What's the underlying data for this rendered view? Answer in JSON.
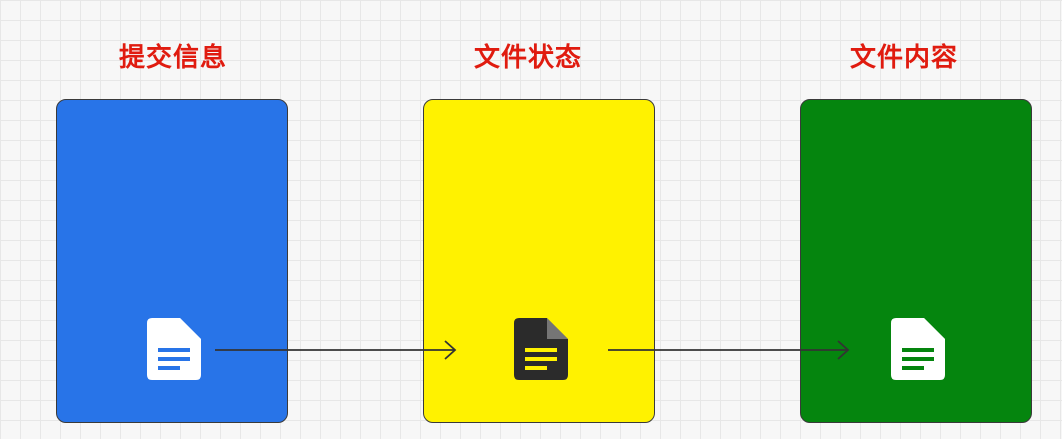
{
  "stages": [
    {
      "title": "提交信息",
      "icon": "document-icon",
      "card_color": "#2874e8",
      "icon_color": "#ffffff",
      "icon_line_color": "#2874e8"
    },
    {
      "title": "文件状态",
      "icon": "document-icon",
      "card_color": "#fff200",
      "icon_color": "#2b2b2b",
      "icon_line_color": "#fff200"
    },
    {
      "title": "文件内容",
      "icon": "document-icon",
      "card_color": "#05850e",
      "icon_color": "#ffffff",
      "icon_line_color": "#05850e"
    }
  ],
  "title_color": "#e01b0f",
  "arrow_color": "#333333",
  "card_border_color": "#3a3a3a"
}
